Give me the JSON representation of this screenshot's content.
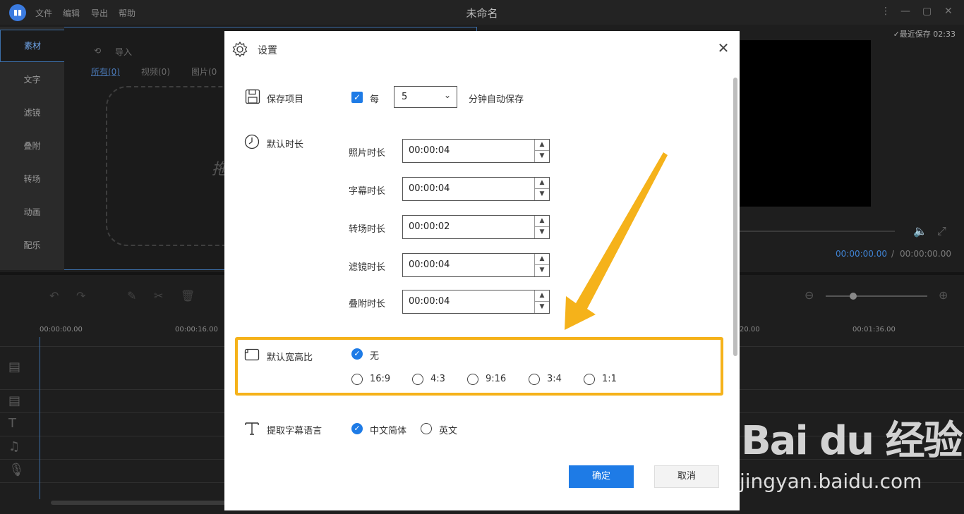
{
  "app": {
    "title": "未命名",
    "menus": [
      "文件",
      "编辑",
      "导出",
      "帮助"
    ],
    "saved_status": "最近保存 02:33"
  },
  "sidebar": {
    "tabs": [
      "素材",
      "文字",
      "滤镜",
      "叠附",
      "转场",
      "动画",
      "配乐"
    ],
    "active": "素材"
  },
  "media": {
    "import_label": "导入",
    "filters": [
      "所有(0)",
      "视频(0)",
      "图片(0"
    ],
    "drop_hint": "拖"
  },
  "preview": {
    "current_time": "00:00:00.00",
    "separator": "/",
    "total_time": "00:00:00.00"
  },
  "timeline": {
    "ruler": [
      "00:00:00.00",
      "00:00:16.00",
      "20.00",
      "00:01:36.00"
    ]
  },
  "dialog": {
    "title": "设置",
    "close_glyph": "✕",
    "save": {
      "label": "保存项目",
      "every": "每",
      "interval": "5",
      "suffix": "分钟自动保存",
      "checked": true
    },
    "duration": {
      "label": "默认时长",
      "fields": [
        {
          "label": "照片时长",
          "value": "00:00:04"
        },
        {
          "label": "字幕时长",
          "value": "00:00:04"
        },
        {
          "label": "转场时长",
          "value": "00:00:02"
        },
        {
          "label": "滤镜时长",
          "value": "00:00:04"
        },
        {
          "label": "叠附时长",
          "value": "00:00:04"
        }
      ]
    },
    "aspect": {
      "label": "默认宽高比",
      "selected": "无",
      "options": [
        "16:9",
        "4:3",
        "9:16",
        "3:4",
        "1:1"
      ]
    },
    "subtitle_lang": {
      "label": "提取字幕语言",
      "options": [
        "中文简体",
        "英文"
      ],
      "selected": "中文简体"
    },
    "ok": "确定",
    "cancel": "取消"
  },
  "watermark": {
    "line1": "Bai du 经验",
    "line2": "jingyan.baidu.com"
  },
  "colors": {
    "accent": "#1e7be6",
    "highlight": "#f5b21a",
    "arrow": "#f5b21a"
  }
}
